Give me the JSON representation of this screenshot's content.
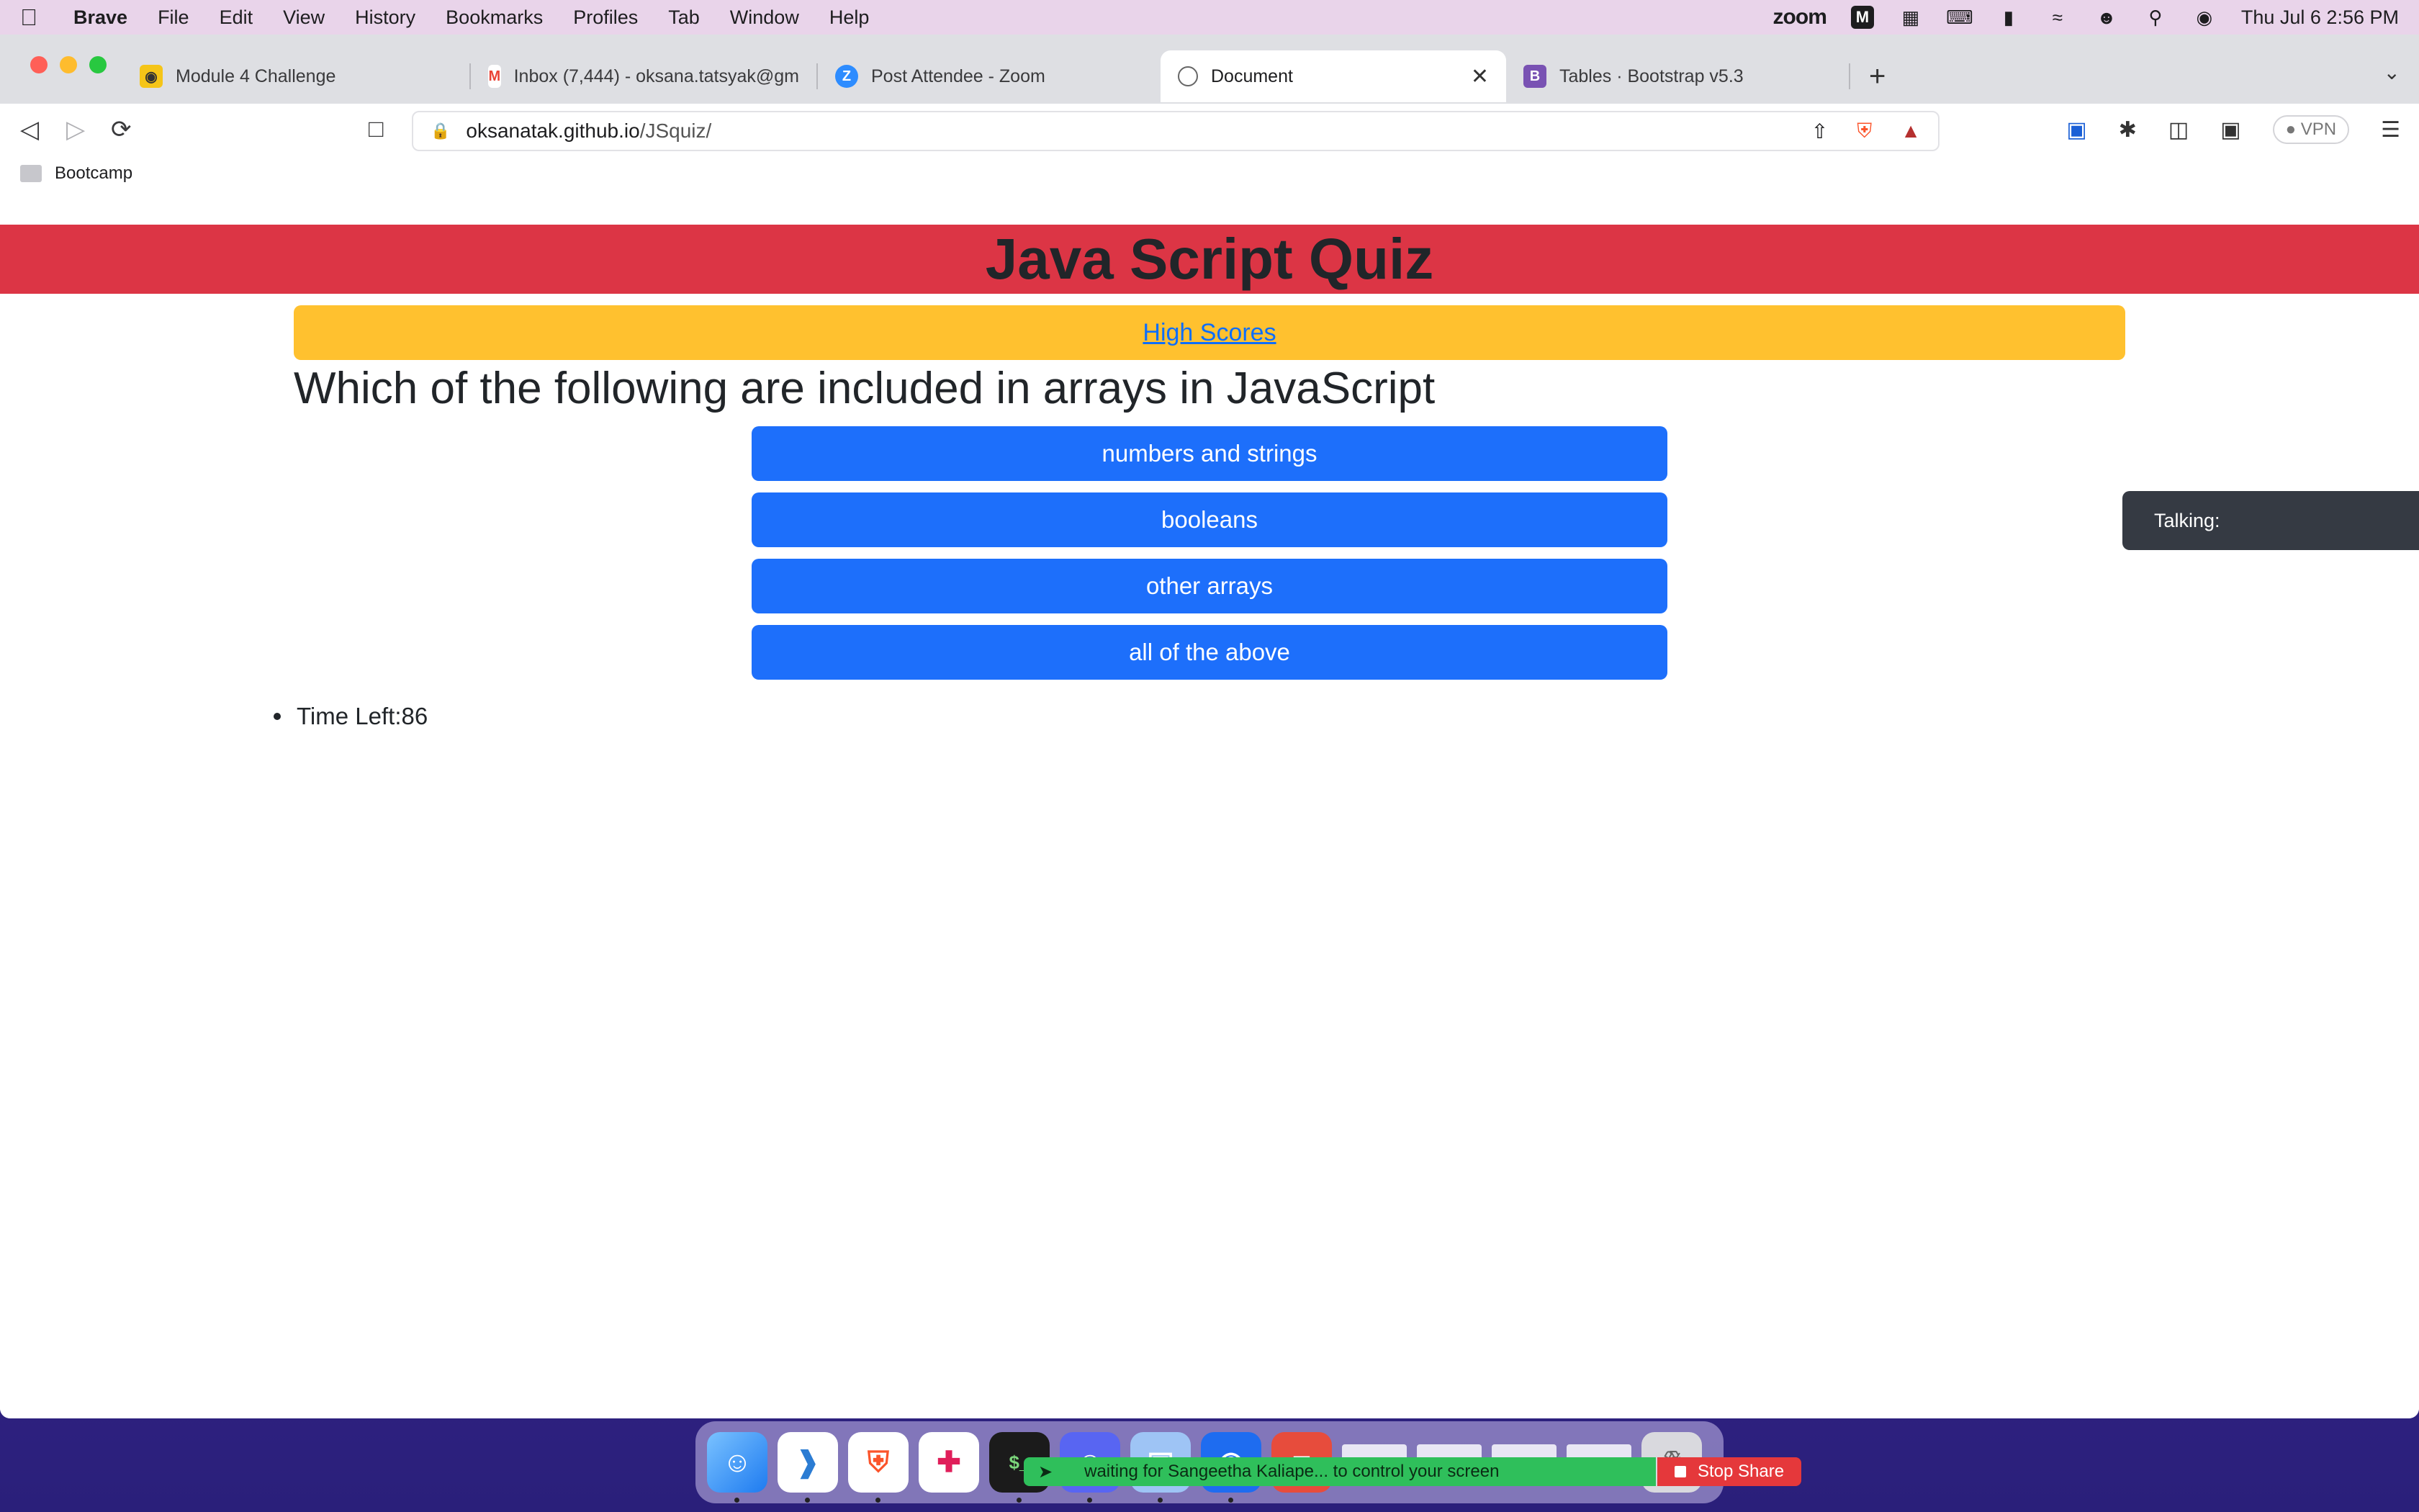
{
  "menubar": {
    "app": "Brave",
    "items": [
      "File",
      "Edit",
      "View",
      "History",
      "Bookmarks",
      "Profiles",
      "Tab",
      "Window",
      "Help"
    ],
    "zoom_label": "zoom",
    "clock": "Thu Jul 6  2:56 PM"
  },
  "tabs": [
    {
      "label": "Module 4 Challenge"
    },
    {
      "label": "Inbox (7,444) - oksana.tatsyak@gm"
    },
    {
      "label": "Post Attendee - Zoom"
    },
    {
      "label": "Document"
    },
    {
      "label": "Tables · Bootstrap v5.3"
    }
  ],
  "url": {
    "host": "oksanatak.github.io",
    "path": "/JSquiz/"
  },
  "vpn_label": "VPN",
  "bookmarks": [
    {
      "label": "Bootcamp"
    }
  ],
  "page": {
    "title": "Java Script Quiz",
    "high_scores": "High Scores",
    "question": "Which of the following are included in arrays in JavaScript",
    "answers": [
      "numbers and strings",
      "booleans",
      "other arrays",
      "all of the above"
    ],
    "timer": "Time Left:86"
  },
  "talking_label": "Talking:",
  "zoom": {
    "banner": "waiting for Sangeetha Kaliape... to control your screen",
    "stop_share": "Stop Share"
  },
  "colors": {
    "header": "#dc3545",
    "highscores_bg": "#ffc12f",
    "answer_btn": "#1d6ffb",
    "zoom_green": "#2fbf5b",
    "stop_red": "#e5383b"
  }
}
